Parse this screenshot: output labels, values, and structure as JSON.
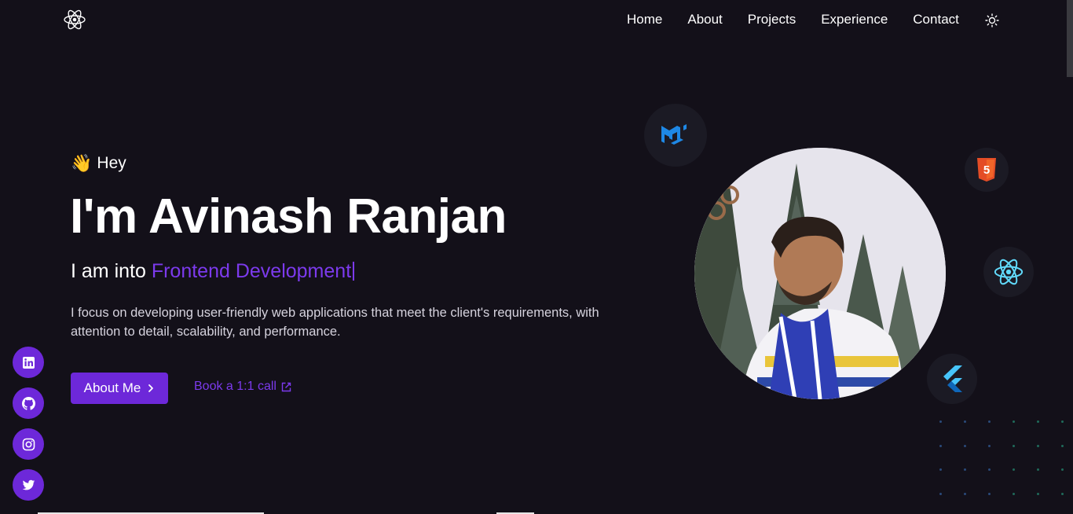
{
  "nav": {
    "logo": "react-logo",
    "items": [
      "Home",
      "About",
      "Projects",
      "Experience",
      "Contact"
    ],
    "theme_toggle_icon": "sun-icon"
  },
  "hero": {
    "greeting_emoji": "👋",
    "greeting": "Hey",
    "title": "I'm Avinash Ranjan",
    "role_prefix": "I am into ",
    "role_highlight": "Frontend Development",
    "description": "I focus on developing user-friendly web applications that meet the client's requirements, with attention to detail, scalability, and performance.",
    "primary_button": "About Me",
    "secondary_link": "Book a 1:1 call"
  },
  "social": [
    "linkedin-icon",
    "github-icon",
    "instagram-icon",
    "twitter-icon"
  ],
  "tech_icons": [
    "mui-icon",
    "html5-icon",
    "react-icon",
    "flutter-icon"
  ],
  "colors": {
    "background": "#131019",
    "accent": "#6d28d9",
    "accent_text": "#7c3aed"
  }
}
